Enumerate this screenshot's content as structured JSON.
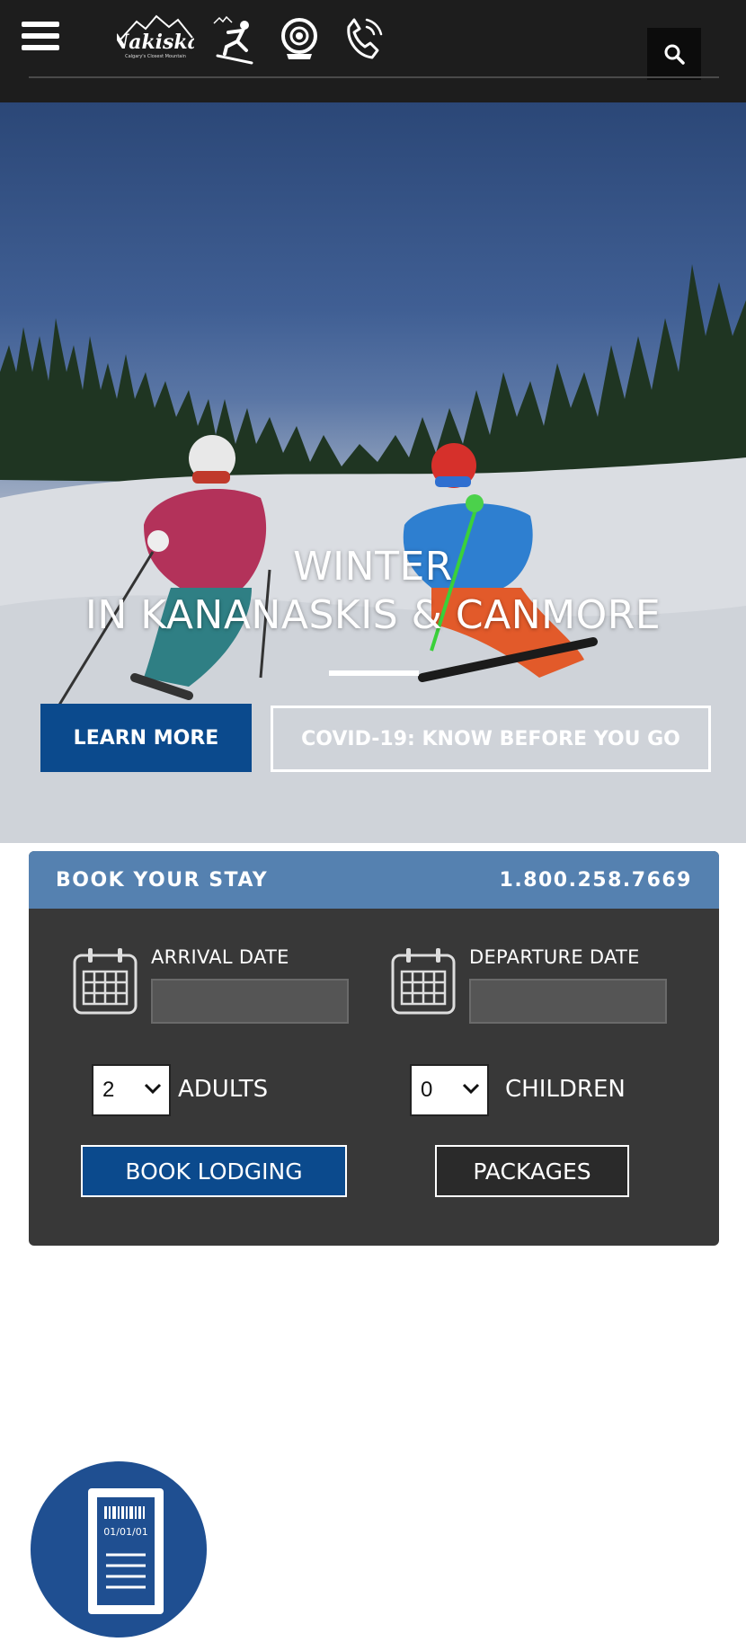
{
  "header": {
    "logo_text": "Nakiska",
    "logo_tagline": "Calgary's Closest Mountain",
    "icons": [
      "menu-icon",
      "skier-icon",
      "webcam-icon",
      "phone-icon",
      "search-icon"
    ]
  },
  "hero": {
    "title_line1": "WINTER",
    "title_line2": "IN KANANASKIS & CANMORE",
    "learn_more_label": "LEARN MORE",
    "covid_label": "COVID-19: KNOW BEFORE YOU GO"
  },
  "booking": {
    "heading": "BOOK YOUR STAY",
    "phone": "1.800.258.7669",
    "arrival_label": "ARRIVAL DATE",
    "departure_label": "DEPARTURE DATE",
    "arrival_value": "",
    "departure_value": "",
    "adults_value": "2",
    "adults_label": "ADULTS",
    "children_value": "0",
    "children_label": "CHILDREN",
    "book_lodging_label": "BOOK LODGING",
    "packages_label": "PACKAGES"
  },
  "ticket": {
    "date_text": "01/01/01",
    "icon": "lift-ticket-icon"
  },
  "colors": {
    "header_bg": "#1d1d1d",
    "brand_blue": "#0b4a8d",
    "booking_header": "#5581b0",
    "booking_body": "#383838"
  }
}
